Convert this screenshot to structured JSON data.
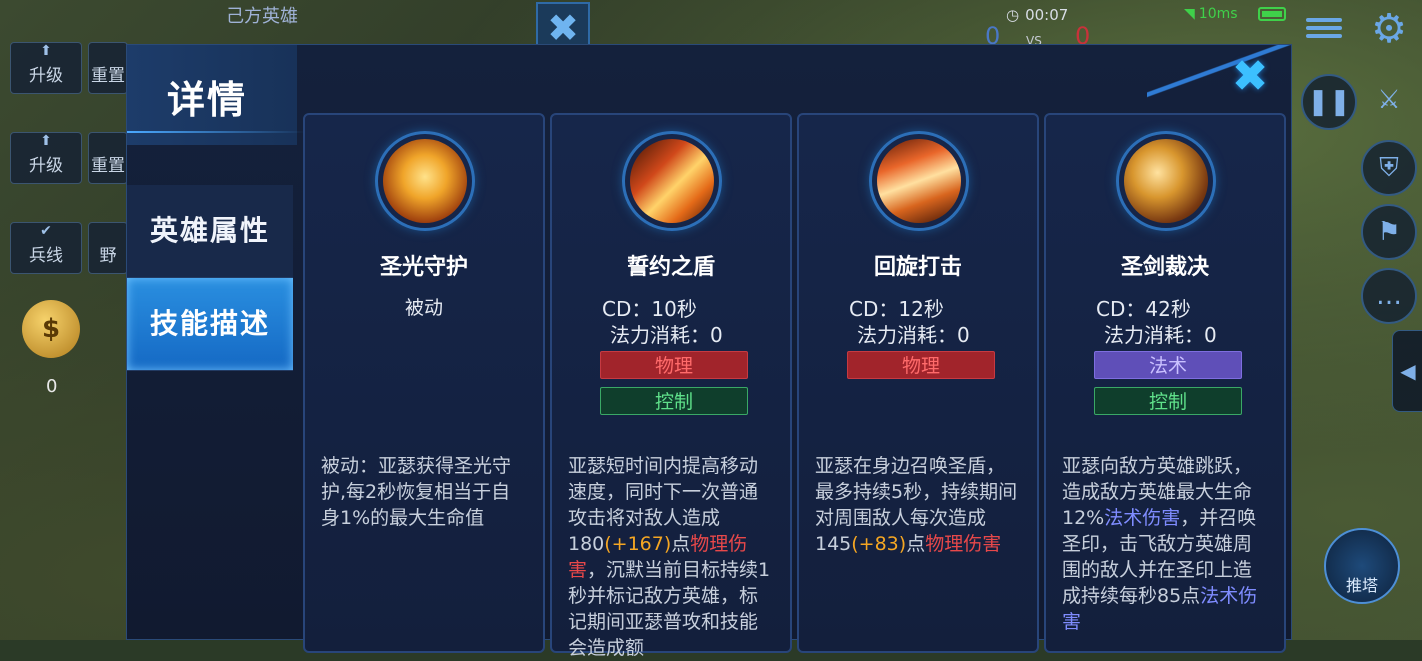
{
  "hud": {
    "top_title": "己方英雄",
    "time": "00:07",
    "score_left": "0",
    "vs": "VS",
    "score_right": "0",
    "ping": "10ms",
    "buttons": [
      {
        "icon": "arrow-up-icon",
        "label": "升级"
      },
      {
        "label": "重置"
      },
      {
        "icon": "arrow-up-icon",
        "label": "升级"
      },
      {
        "label": "重置"
      },
      {
        "icon": "check-icon",
        "label": "兵线"
      },
      {
        "label": "野"
      }
    ],
    "money_value": "0",
    "push_label": "推塔"
  },
  "dialog": {
    "title": "详情",
    "nav": [
      {
        "label": "英雄属性",
        "active": false
      },
      {
        "label": "技能描述",
        "active": true
      }
    ],
    "skills": [
      {
        "name": "圣光守护",
        "type": "被动",
        "desc_segments": [
          {
            "text": "被动：亚瑟获得圣光守护,每2秒恢复相当于自身1%的最大生命值",
            "style": "normal"
          }
        ],
        "icon_colors": [
          "#f7c544",
          "#b5430f"
        ]
      },
      {
        "name": "誓约之盾",
        "cd": "CD：10秒",
        "mana": "法力消耗：0",
        "tags": [
          {
            "label": "物理",
            "kind": "phys"
          },
          {
            "label": "控制",
            "kind": "ctrl"
          }
        ],
        "desc_segments": [
          {
            "text": "亚瑟短时间内提高移动速度，同时下一次普通攻击将对敌人造成180",
            "style": "normal"
          },
          {
            "text": "(+167)",
            "style": "orange"
          },
          {
            "text": "点",
            "style": "normal"
          },
          {
            "text": "物理伤害",
            "style": "red"
          },
          {
            "text": "，沉默当前目标持续1秒并标记敌方英雄，标记期间亚瑟普攻和技能会造成额",
            "style": "normal"
          }
        ],
        "icon_colors": [
          "#ffd36a",
          "#c0350c"
        ]
      },
      {
        "name": "回旋打击",
        "cd": "CD：12秒",
        "mana": "法力消耗：0",
        "tags": [
          {
            "label": "物理",
            "kind": "phys"
          }
        ],
        "desc_segments": [
          {
            "text": "亚瑟在身边召唤圣盾，最多持续5秒，持续期间对周围敌人每次造成145",
            "style": "normal"
          },
          {
            "text": "(+83)",
            "style": "orange"
          },
          {
            "text": "点",
            "style": "normal"
          },
          {
            "text": "物理伤害",
            "style": "red"
          }
        ],
        "icon_colors": [
          "#ffcf7a",
          "#a8320e"
        ]
      },
      {
        "name": "圣剑裁决",
        "cd": "CD：42秒",
        "mana": "法力消耗：0",
        "tags": [
          {
            "label": "法术",
            "kind": "mag"
          },
          {
            "label": "控制",
            "kind": "ctrl"
          }
        ],
        "desc_segments": [
          {
            "text": "亚瑟向敌方英雄跳跃，造成敌方英雄最大生命12%",
            "style": "normal"
          },
          {
            "text": "法术伤害",
            "style": "blue"
          },
          {
            "text": "，并召唤圣印，击飞敌方英雄周围的敌人并在圣印上造成持续每秒85点",
            "style": "normal"
          },
          {
            "text": "法术伤害",
            "style": "blue"
          }
        ],
        "icon_colors": [
          "#e8b650",
          "#6e3b12"
        ]
      }
    ]
  },
  "colors": {
    "accent": "#2a8fe0",
    "physical": "#a1242b",
    "control": "#0f3e2c",
    "magic": "#5f4fb8",
    "highlight_orange": "#f5a623",
    "highlight_red": "#e8484a",
    "highlight_blue": "#7f8cff"
  }
}
